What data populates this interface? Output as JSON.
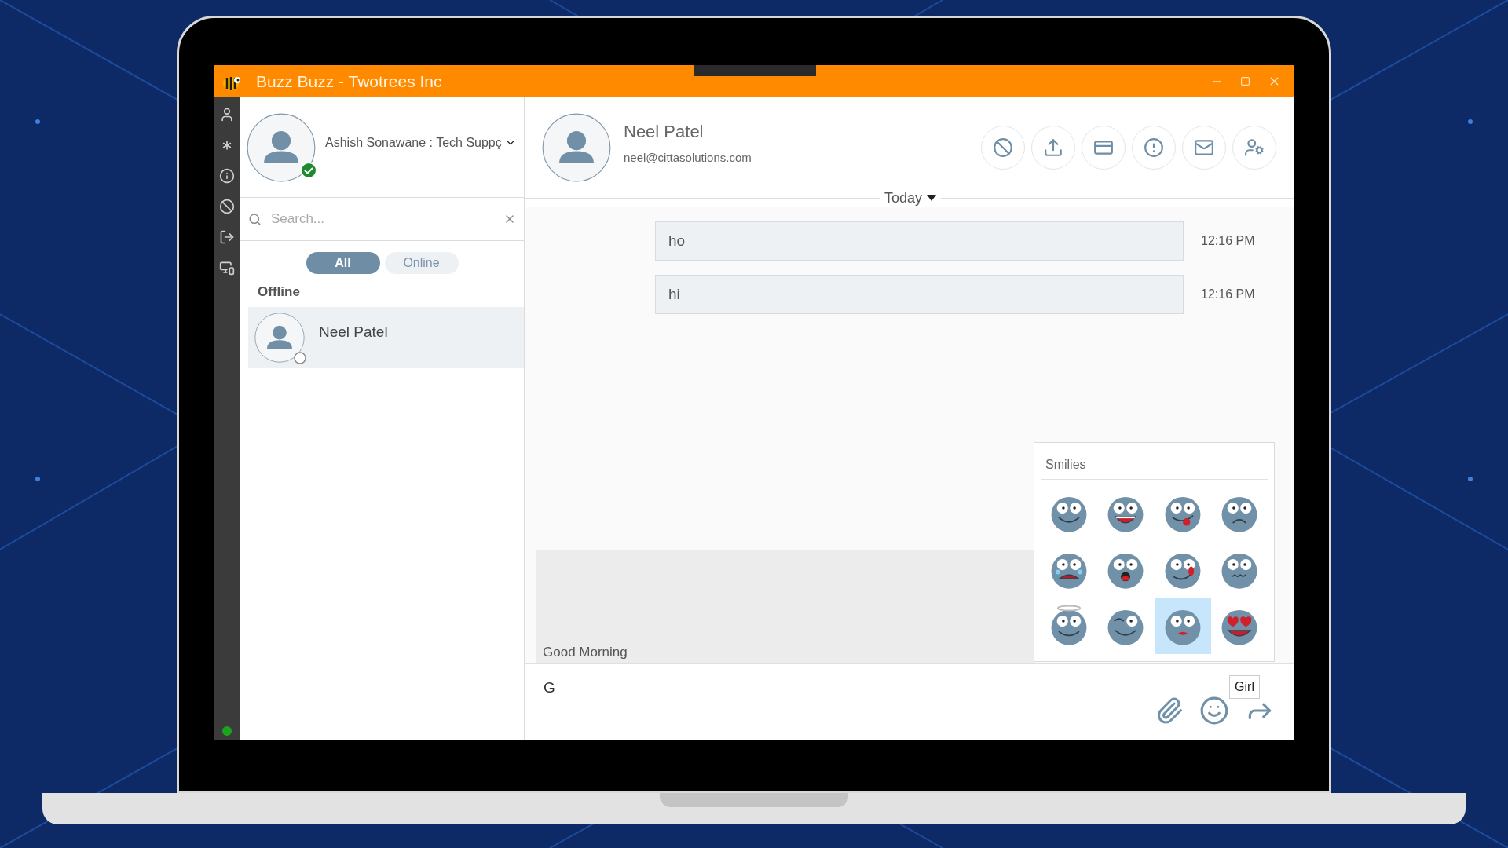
{
  "window": {
    "title": "Buzz Buzz - Twotrees Inc"
  },
  "rail": [
    {
      "kind": "user",
      "selected": false
    },
    {
      "kind": "asterisk",
      "selected": false
    },
    {
      "kind": "info",
      "selected": false
    },
    {
      "kind": "block",
      "selected": false
    },
    {
      "kind": "logout",
      "selected": false
    },
    {
      "kind": "screen",
      "selected": false
    }
  ],
  "connection": {
    "online": true
  },
  "profile": {
    "name": "Ashish Sonawane : Tech Suppç",
    "online": true
  },
  "search": {
    "placeholder": "Search..."
  },
  "filters": [
    {
      "label": "All",
      "selected": true
    },
    {
      "label": "Online",
      "selected": false
    }
  ],
  "group": "Offline",
  "contacts": [
    {
      "name": "Neel Patel",
      "selected": true,
      "online": false
    }
  ],
  "chat": {
    "name": "Neel Patel",
    "email": "neel@cittasolutions.com"
  },
  "actions": [
    {
      "kind": "block"
    },
    {
      "kind": "upload"
    },
    {
      "kind": "card"
    },
    {
      "kind": "alert"
    },
    {
      "kind": "mail"
    },
    {
      "kind": "user"
    }
  ],
  "date": "Today",
  "messages": [
    {
      "text": "ho",
      "time": "12:16 PM"
    },
    {
      "text": "hi",
      "time": "12:16 PM"
    }
  ],
  "suggestion": "Good Morning",
  "composer": {
    "value": "G"
  },
  "smilies": {
    "title": "Smilies",
    "items": [
      {
        "kind": "smile",
        "selected": false
      },
      {
        "kind": "grin",
        "selected": false
      },
      {
        "kind": "tongue",
        "selected": false
      },
      {
        "kind": "sad",
        "selected": false
      },
      {
        "kind": "cry",
        "selected": false
      },
      {
        "kind": "surprised",
        "selected": false
      },
      {
        "kind": "lick",
        "selected": false
      },
      {
        "kind": "worried",
        "selected": false
      },
      {
        "kind": "angel",
        "selected": false
      },
      {
        "kind": "wink",
        "selected": false
      },
      {
        "kind": "girl",
        "selected": true
      },
      {
        "kind": "love",
        "selected": false
      }
    ]
  },
  "tooltip": "Girl"
}
